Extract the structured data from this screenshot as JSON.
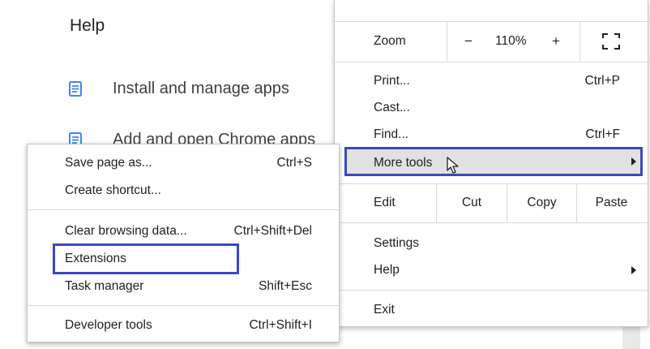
{
  "help_page": {
    "title": "Help",
    "items": [
      {
        "label": "Install and manage apps",
        "icon": "document-icon"
      },
      {
        "label": "Add and open Chrome apps",
        "icon": "document-icon"
      }
    ]
  },
  "main_menu": {
    "zoom": {
      "label": "Zoom",
      "minus": "−",
      "value": "110%",
      "plus": "+",
      "fullscreen_icon": "fullscreen-icon"
    },
    "print": {
      "label": "Print...",
      "shortcut": "Ctrl+P"
    },
    "cast": {
      "label": "Cast..."
    },
    "find": {
      "label": "Find...",
      "shortcut": "Ctrl+F"
    },
    "more_tools": {
      "label": "More tools"
    },
    "edit": {
      "label": "Edit",
      "cut": "Cut",
      "copy": "Copy",
      "paste": "Paste"
    },
    "settings": {
      "label": "Settings"
    },
    "help": {
      "label": "Help"
    },
    "exit": {
      "label": "Exit"
    }
  },
  "more_tools_submenu": {
    "save_page": {
      "label": "Save page as...",
      "shortcut": "Ctrl+S"
    },
    "create_shortcut": {
      "label": "Create shortcut..."
    },
    "clear_browsing": {
      "label": "Clear browsing data...",
      "shortcut": "Ctrl+Shift+Del"
    },
    "extensions": {
      "label": "Extensions"
    },
    "task_manager": {
      "label": "Task manager",
      "shortcut": "Shift+Esc"
    },
    "developer_tools": {
      "label": "Developer tools",
      "shortcut": "Ctrl+Shift+I"
    }
  },
  "colors": {
    "highlight_border": "#3b47c4",
    "icon_blue": "#4285f4",
    "hover_bg": "#e1e1e1"
  }
}
